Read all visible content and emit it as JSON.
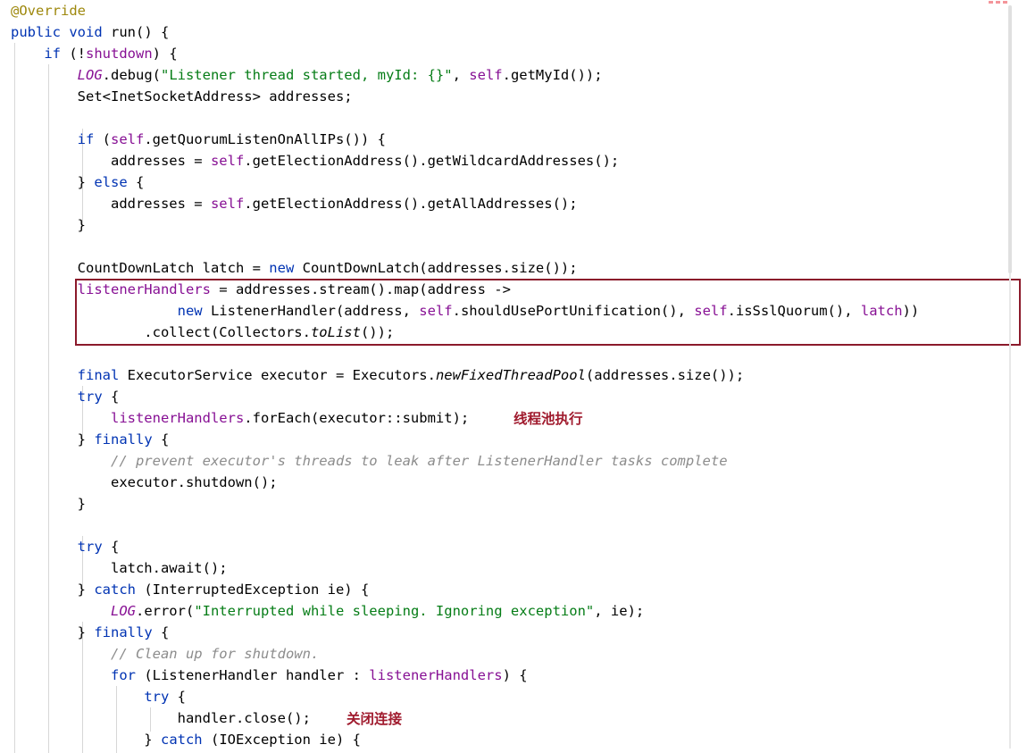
{
  "editor": {
    "language": "java",
    "theme": "light",
    "colors": {
      "background": "#ffffff",
      "foreground": "#000000",
      "keyword": "#0033b3",
      "field": "#871094",
      "string": "#067d17",
      "comment": "#8c8c8c",
      "annotation": "#9e880d",
      "highlight_border": "#8b1a2b",
      "note": "#a01b2e",
      "indent_guide": "#d7d7d7"
    }
  },
  "code": {
    "lines": [
      {
        "id": "l01",
        "text": "@Override"
      },
      {
        "id": "l02",
        "text": "public void run() {"
      },
      {
        "id": "l03",
        "text": "    if (!shutdown) {"
      },
      {
        "id": "l04",
        "text": "        LOG.debug(\"Listener thread started, myId: {}\", self.getMyId());"
      },
      {
        "id": "l05",
        "text": "        Set<InetSocketAddress> addresses;"
      },
      {
        "id": "l06",
        "text": ""
      },
      {
        "id": "l07",
        "text": "        if (self.getQuorumListenOnAllIPs()) {"
      },
      {
        "id": "l08",
        "text": "            addresses = self.getElectionAddress().getWildcardAddresses();"
      },
      {
        "id": "l09",
        "text": "        } else {"
      },
      {
        "id": "l10",
        "text": "            addresses = self.getElectionAddress().getAllAddresses();"
      },
      {
        "id": "l11",
        "text": "        }"
      },
      {
        "id": "l12",
        "text": ""
      },
      {
        "id": "l13",
        "text": "        CountDownLatch latch = new CountDownLatch(addresses.size());"
      },
      {
        "id": "l14",
        "text": "        listenerHandlers = addresses.stream().map(address ->"
      },
      {
        "id": "l15",
        "text": "                    new ListenerHandler(address, self.shouldUsePortUnification(), self.isSslQuorum(), latch))"
      },
      {
        "id": "l16",
        "text": "                .collect(Collectors.toList());"
      },
      {
        "id": "l17",
        "text": ""
      },
      {
        "id": "l18",
        "text": "        final ExecutorService executor = Executors.newFixedThreadPool(addresses.size());"
      },
      {
        "id": "l19",
        "text": "        try {"
      },
      {
        "id": "l20",
        "text": "            listenerHandlers.forEach(executor::submit);"
      },
      {
        "id": "l21",
        "text": "        } finally {"
      },
      {
        "id": "l22",
        "text": "            // prevent executor's threads to leak after ListenerHandler tasks complete"
      },
      {
        "id": "l23",
        "text": "            executor.shutdown();"
      },
      {
        "id": "l24",
        "text": "        }"
      },
      {
        "id": "l25",
        "text": ""
      },
      {
        "id": "l26",
        "text": "        try {"
      },
      {
        "id": "l27",
        "text": "            latch.await();"
      },
      {
        "id": "l28",
        "text": "        } catch (InterruptedException ie) {"
      },
      {
        "id": "l29",
        "text": "            LOG.error(\"Interrupted while sleeping. Ignoring exception\", ie);"
      },
      {
        "id": "l30",
        "text": "        } finally {"
      },
      {
        "id": "l31",
        "text": "            // Clean up for shutdown."
      },
      {
        "id": "l32",
        "text": "            for (ListenerHandler handler : listenerHandlers) {"
      },
      {
        "id": "l33",
        "text": "                try {"
      },
      {
        "id": "l34",
        "text": "                    handler.close();"
      },
      {
        "id": "l35",
        "text": "                } catch (IOException ie) {"
      }
    ]
  },
  "annotations": {
    "highlight_box": {
      "label": "listener-handlers-creation-highlight",
      "covers_lines": [
        "l14",
        "l15",
        "l16"
      ]
    },
    "notes": [
      {
        "id": "note-thread-pool",
        "text": "线程池执行",
        "line": "l20"
      },
      {
        "id": "note-close-connection",
        "text": "关闭连接",
        "line": "l34"
      }
    ]
  },
  "scrollbar": {
    "marker_count": 3
  }
}
